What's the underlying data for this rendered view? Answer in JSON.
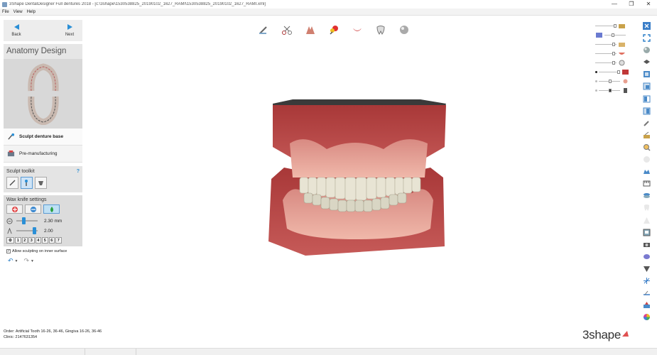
{
  "window": {
    "title": "3Shape DentalDesigner Full dentures 2018 - [c:\\3shape\\1530538825_20190102_1627_RAMI\\1530538825_20190102_1627_RAMI.xml]",
    "minimize": "—",
    "maximize": "❐",
    "close": "✕"
  },
  "menu": [
    "File",
    "View",
    "Help"
  ],
  "nav": {
    "back": "Back",
    "next": "Next"
  },
  "panel": {
    "title": "Anatomy Design"
  },
  "steps": [
    {
      "label": "Sculpt denture base",
      "icon": "sculpt-icon"
    },
    {
      "label": "Pre-manufacturing",
      "icon": "premanufacturing-icon"
    }
  ],
  "toolkit": {
    "title": "Sculpt toolkit",
    "help": "?",
    "tools": [
      "pencil-tool-icon",
      "wax-knife-tool-icon",
      "morph-tool-icon"
    ]
  },
  "wax_knife": {
    "title": "Wax knife settings",
    "modes": [
      "add-wax-icon",
      "remove-wax-icon",
      "smooth-wax-icon"
    ],
    "size": {
      "value": "2.30 mm",
      "level": 0.3
    },
    "strength": {
      "value": "2.00",
      "level": 0.9
    },
    "presets": [
      "1",
      "2",
      "3",
      "4",
      "5",
      "6",
      "7"
    ],
    "allow_inner": {
      "label": "Allow sculpting on inner surface",
      "checked": true
    }
  },
  "order": {
    "order_label": "Order:",
    "order_value": "Artificial Tooth 16-26, 36-46, Gingiva 16-26, 36-46",
    "clinic_label": "Clinic:",
    "clinic_value": "2147631354"
  },
  "brand": {
    "logo": "3shape"
  },
  "colors": {
    "accent": "#2a8fd6",
    "gingiva": "#c0504f",
    "teeth": "#e8e4d4",
    "logo_red": "#e05050"
  }
}
